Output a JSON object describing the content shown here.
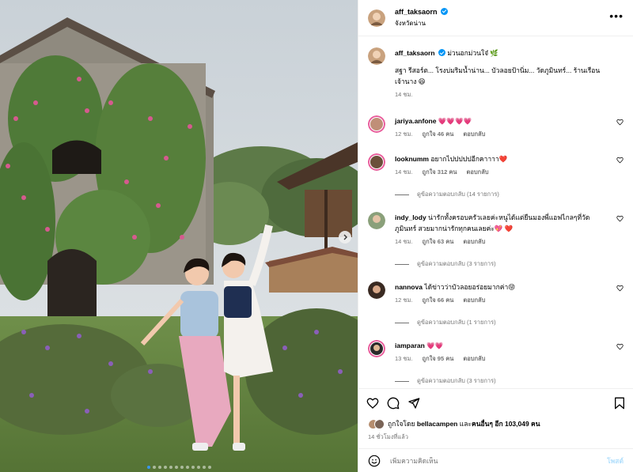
{
  "header": {
    "username": "aff_taksaorn",
    "location": "จังหวัดน่าน",
    "more_icon": "more-horizontal-icon"
  },
  "caption": {
    "username": "aff_taksaorn",
    "tag": "ม่วนอกม่วนใจ๋ 🌿",
    "text": "สฐา รีสอร์ต... โรงบ่มริมน้ำน่าน... บัวลอยป้านิ่ม... วัดภูมินทร์... ร้านเรือนเจ้านาง 😆",
    "time": "14 ชม."
  },
  "comments": [
    {
      "username": "jariya.anfone",
      "text": "💗💗💗💗",
      "time": "12 ชม.",
      "likes": "ถูกใจ 46 คน",
      "reply": "ตอบกลับ",
      "view_replies": ""
    },
    {
      "username": "looknumm",
      "text": "อยากไปปปปปอีกคาาาา❤️",
      "time": "14 ชม.",
      "likes": "ถูกใจ 312 คน",
      "reply": "ตอบกลับ",
      "view_replies": "ดูข้อความตอบกลับ (14 รายการ)"
    },
    {
      "username": "indy_lody",
      "text": "น่ารักทั้งครอบครัวเลยค่ะหนูได้แต่ยืนมองพี่แอฟไกลๆที่วัดภูมินทร์ สวยมากน่ารักทุกคนเลยค่ะ💖 ❤️",
      "time": "14 ชม.",
      "likes": "ถูกใจ 63 คน",
      "reply": "ตอบกลับ",
      "view_replies": "ดูข้อความตอบกลับ (3 รายการ)"
    },
    {
      "username": "nannova",
      "text": "ได้ข่าวว่าบัวลอยอร่อยมากค่า😝",
      "time": "12 ชม.",
      "likes": "ถูกใจ 66 คน",
      "reply": "ตอบกลับ",
      "view_replies": "ดูข้อความตอบกลับ (1 รายการ)"
    },
    {
      "username": "iamparan",
      "text": "💗💗",
      "time": "13 ชม.",
      "likes": "ถูกใจ 95 คน",
      "reply": "ตอบกลับ",
      "view_replies": "ดูข้อความตอบกลับ (3 รายการ)"
    }
  ],
  "likes": {
    "prefix": "ถูกใจโดย",
    "user": "bellacampen",
    "middle": "และ",
    "others": "คนอื่นๆ อีก 103,049 คน"
  },
  "time_ago": "14 ชั่วโมงที่แล้ว",
  "add_comment": {
    "placeholder": "เพิ่มความคิดเห็น",
    "post_label": "โพสต์"
  },
  "colors": {
    "accent": "#0095f6",
    "muted": "#737373",
    "border": "#efefef"
  }
}
